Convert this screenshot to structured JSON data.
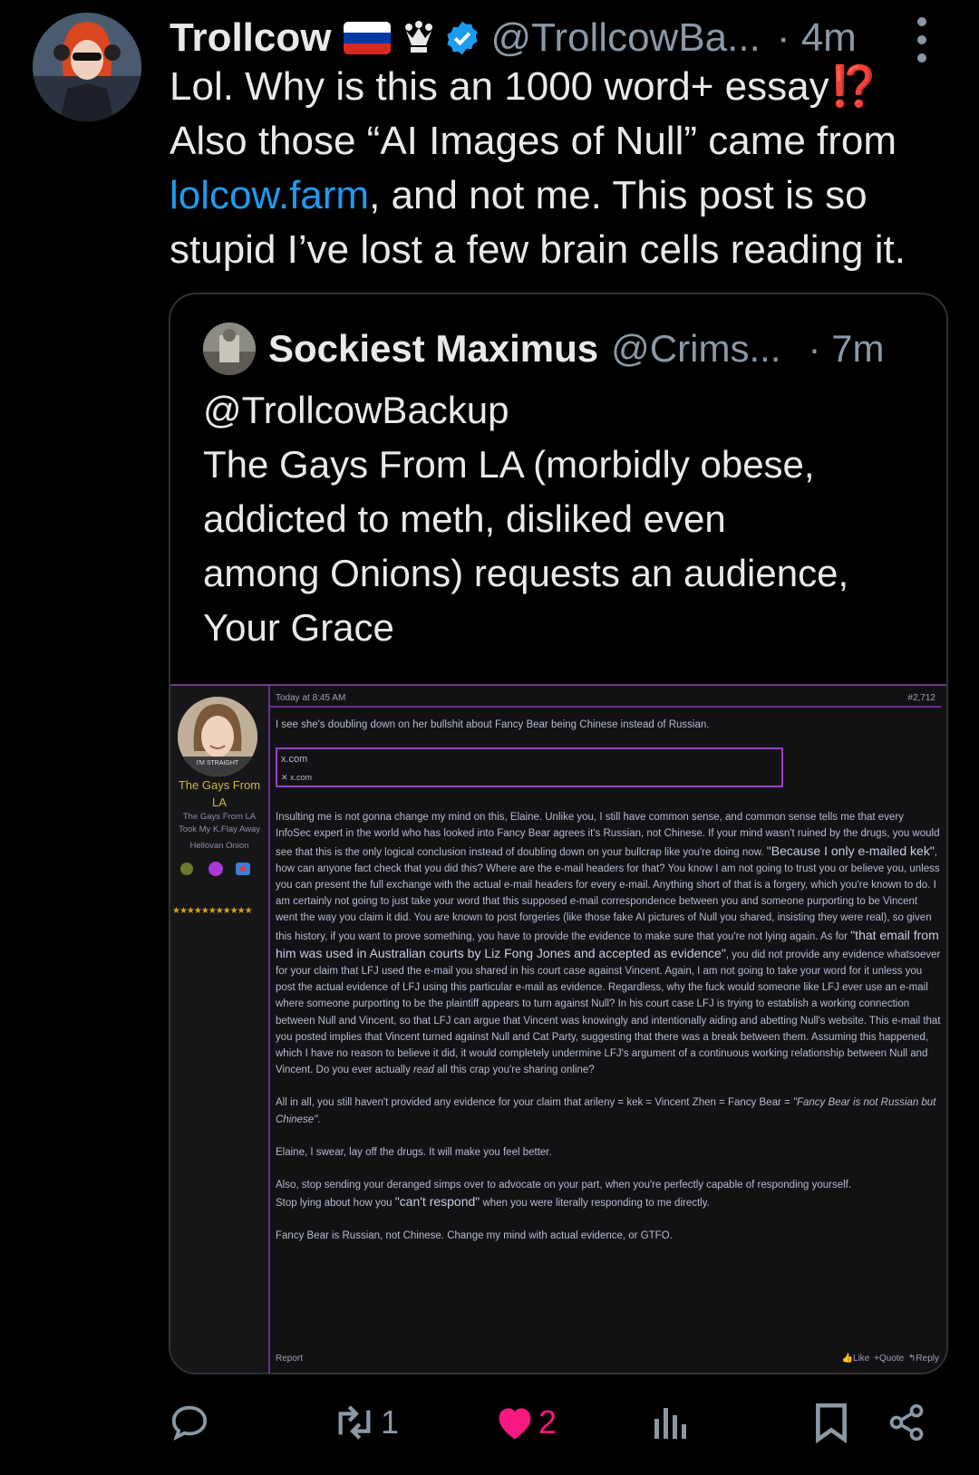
{
  "post": {
    "author_name": "Trollcow",
    "handle": "@TrollcowBa...",
    "time": "· 4m",
    "flag_icon": "russia-flag-icon",
    "text_line1": "Lol. Why is this an 1000 word+ essay",
    "text_emoji": "⁉️",
    "text_line2": "Also those “AI Images of Null” came from",
    "link_text": "lolcow.farm",
    "text_after_link": ", and not me. This post is so",
    "text_line4": "stupid I’ve lost a few brain cells reading it."
  },
  "quote": {
    "author_name": "Sockiest Maximus",
    "handle": "@Crims...",
    "time": "· 7m",
    "mention": "@TrollcowBackup",
    "text_line1": "The Gays From LA (morbidly obese,",
    "text_line2": "addicted to meth, disliked even",
    "text_line3": "among Onions) requests an audience,",
    "text_line4": "Your Grace"
  },
  "forum": {
    "badge": "I'M STRAIGHT",
    "username": "The Gays From LA",
    "subtitle1": "The Gays From LA",
    "subtitle2": "Took My K.Flay Away",
    "subtitle3": "Hellovan Onion",
    "stars": "★★★★★★★★★★★",
    "date": "Today at 8:45 AM",
    "post_number": "#2,712",
    "p1": "I see she's doubling down on her bullshit about Fancy Bear being Chinese instead of Russian.",
    "embed_title": "x.com",
    "embed_sub": "x.com",
    "p2a": "Insulting me is not gonna change my mind on this, Elaine. Unlike you, I still have common sense, and common sense tells me that every InfoSec expert in the world who has looked into Fancy Bear agrees it's Russian, not Chinese. If your mind wasn't ruined by the drugs, you would see that this is the only logical conclusion instead of doubling down on your bullcrap like you're doing now. ",
    "q1": "\"Because I only e-mailed kek\"",
    "p2b": ", how can anyone fact check that you did this? Where are the e-mail headers for that? You know I am not going to trust you or believe you, unless you can present the full exchange with the actual e-mail headers for every e-mail. Anything short of that is a forgery, which you're known to do. I am certainly not going to just take your word that this supposed e-mail correspondence between you and someone purporting to be Vincent went the way you claim it did. You are known to post forgeries (like those fake AI pictures of Null you shared, insisting they were real), so given this history, if you want to prove something, you have to provide the evidence to make sure that you're not lying again. As for ",
    "q2": "\"that email from him was used in Australian courts by Liz Fong Jones and accepted as evidence\"",
    "p2c": ", you did not provide any evidence whatsoever for your claim that LFJ used the e-mail you shared in his court case against Vincent. Again, I am not going to take your word for it unless you post the actual evidence of LFJ using this particular e-mail as evidence. Regardless, why the fuck would someone like LFJ ever use an e-mail where someone purporting to be the plaintiff appears to turn against Null? In his court case LFJ is trying to establish a working connection between Null and Vincent, so that LFJ can argue that Vincent was knowingly and intentionally aiding and abetting Null's website. This e-mail that you posted implies that Vincent turned against Null and Cat Party, suggesting that there was a break between them. Assuming this happened, which I have no reason to believe it did, it would completely undermine LFJ's argument of a continuous working relationship between Null and Vincent. Do you ever actually ",
    "p2d": "read",
    "p2e": " all this crap you're sharing online?",
    "p3a": "All in all, you still haven't provided any evidence for your claim that arileny = kek = Vincent Zhen = Fancy Bear = ",
    "p3b": "\"Fancy Bear is not Russian but Chinese\"",
    "p3c": ".",
    "p4": "Elaine, I swear, lay off the drugs. It will make you feel better.",
    "p5": "Also, stop sending your deranged simps over to advocate on your part, when you're perfectly capable of responding yourself.",
    "p6a": "Stop lying about how you ",
    "q3": "\"can't respond\"",
    "p6b": " when you were literally responding to me directly.",
    "p7": "Fancy Bear is Russian, not Chinese. Change my mind with actual evidence, or GTFO.",
    "report": "Report",
    "like": "Like",
    "quote_label": "+Quote",
    "reply": "Reply"
  },
  "actions": {
    "retweet_count": "1",
    "like_count": "2",
    "like_color": "#f91880"
  }
}
